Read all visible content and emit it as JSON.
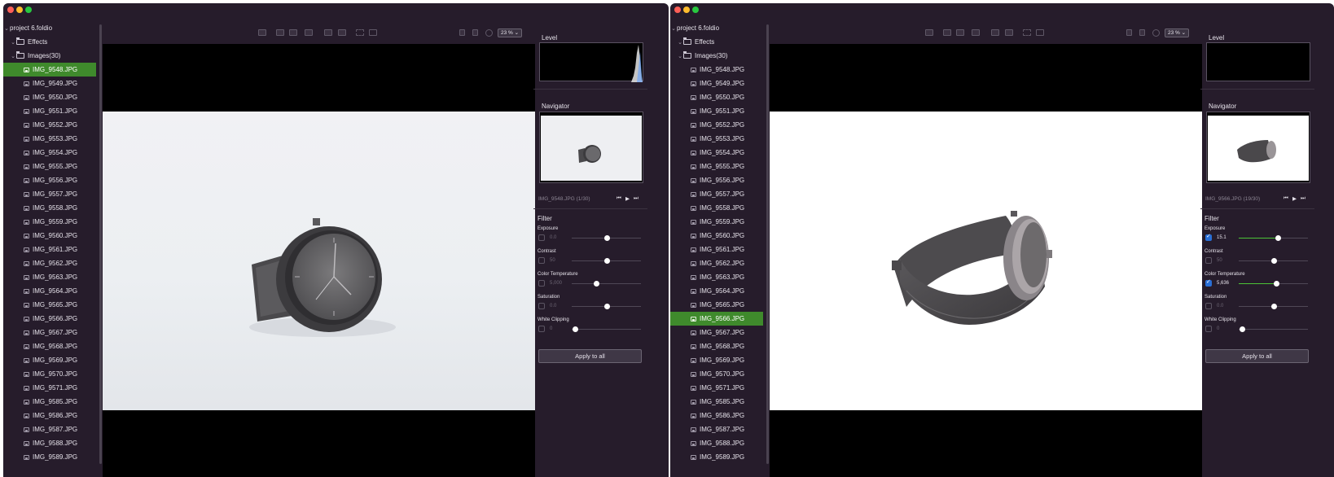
{
  "window1": {
    "project_label": "project 6.foldio",
    "effects_label": "Effects",
    "images_label": "Images(30)",
    "files": [
      "IMG_9548.JPG",
      "IMG_9549.JPG",
      "IMG_9550.JPG",
      "IMG_9551.JPG",
      "IMG_9552.JPG",
      "IMG_9553.JPG",
      "IMG_9554.JPG",
      "IMG_9555.JPG",
      "IMG_9556.JPG",
      "IMG_9557.JPG",
      "IMG_9558.JPG",
      "IMG_9559.JPG",
      "IMG_9560.JPG",
      "IMG_9561.JPG",
      "IMG_9562.JPG",
      "IMG_9563.JPG",
      "IMG_9564.JPG",
      "IMG_9565.JPG",
      "IMG_9566.JPG",
      "IMG_9567.JPG",
      "IMG_9568.JPG",
      "IMG_9569.JPG",
      "IMG_9570.JPG",
      "IMG_9571.JPG",
      "IMG_9585.JPG",
      "IMG_9586.JPG",
      "IMG_9587.JPG",
      "IMG_9588.JPG",
      "IMG_9589.JPG"
    ],
    "selected_file": "IMG_9548.JPG",
    "zoom_label": "23 % ⌄",
    "level_title": "Level",
    "navigator_title": "Navigator",
    "nav_filename": "IMG_9548.JPG (1/30)",
    "filter_title": "Filter",
    "filters": [
      {
        "label": "Exposure",
        "value": "0.0",
        "enabled": false,
        "level": 0.5
      },
      {
        "label": "Contrast",
        "value": "50",
        "enabled": false,
        "level": 0.5
      },
      {
        "label": "Color Temperature",
        "value": "5,000",
        "enabled": false,
        "level": 0.35
      },
      {
        "label": "Saturation",
        "value": "0.0",
        "enabled": false,
        "level": 0.5
      },
      {
        "label": "White Clipping",
        "value": "0",
        "enabled": false,
        "level": 0.05
      }
    ],
    "apply_label": "Apply to all"
  },
  "window2": {
    "project_label": "project 6.foldio",
    "effects_label": "Effects",
    "images_label": "Images(30)",
    "files": [
      "IMG_9548.JPG",
      "IMG_9549.JPG",
      "IMG_9550.JPG",
      "IMG_9551.JPG",
      "IMG_9552.JPG",
      "IMG_9553.JPG",
      "IMG_9554.JPG",
      "IMG_9555.JPG",
      "IMG_9556.JPG",
      "IMG_9557.JPG",
      "IMG_9558.JPG",
      "IMG_9559.JPG",
      "IMG_9560.JPG",
      "IMG_9561.JPG",
      "IMG_9562.JPG",
      "IMG_9563.JPG",
      "IMG_9564.JPG",
      "IMG_9565.JPG",
      "IMG_9566.JPG",
      "IMG_9567.JPG",
      "IMG_9568.JPG",
      "IMG_9569.JPG",
      "IMG_9570.JPG",
      "IMG_9571.JPG",
      "IMG_9585.JPG",
      "IMG_9586.JPG",
      "IMG_9587.JPG",
      "IMG_9588.JPG",
      "IMG_9589.JPG"
    ],
    "selected_file": "IMG_9566.JPG",
    "zoom_label": "23 % ⌄",
    "level_title": "Level",
    "navigator_title": "Navigator",
    "nav_filename": "IMG_9566.JPG (19/30)",
    "filter_title": "Filter",
    "filters": [
      {
        "label": "Exposure",
        "value": "15.1",
        "enabled": true,
        "level": 0.56
      },
      {
        "label": "Contrast",
        "value": "50",
        "enabled": false,
        "level": 0.5
      },
      {
        "label": "Color Temperature",
        "value": "5,636",
        "enabled": true,
        "level": 0.54
      },
      {
        "label": "Saturation",
        "value": "0.0",
        "enabled": false,
        "level": 0.5
      },
      {
        "label": "White Clipping",
        "value": "0",
        "enabled": false,
        "level": 0.05
      }
    ],
    "apply_label": "Apply to all"
  },
  "colors": {
    "window_bg": "#261c2b",
    "selection": "#3f8a2c",
    "slider_fill": "#4cc337",
    "checkbox_on": "#2a6fd6"
  },
  "icons": {
    "traffic_lights": [
      "close-icon",
      "minimize-icon",
      "zoom-window-icon"
    ],
    "toolbar": [
      "single-view-icon",
      "compare-icon",
      "split-view-icon",
      "before-after-icon",
      "grid-view-icon",
      "filmstrip-icon",
      "crop-icon",
      "export-icon",
      "trash-icon",
      "copy-icon",
      "play-icon"
    ],
    "nav": [
      "first-image-icon",
      "next-image-icon",
      "last-image-icon"
    ]
  }
}
